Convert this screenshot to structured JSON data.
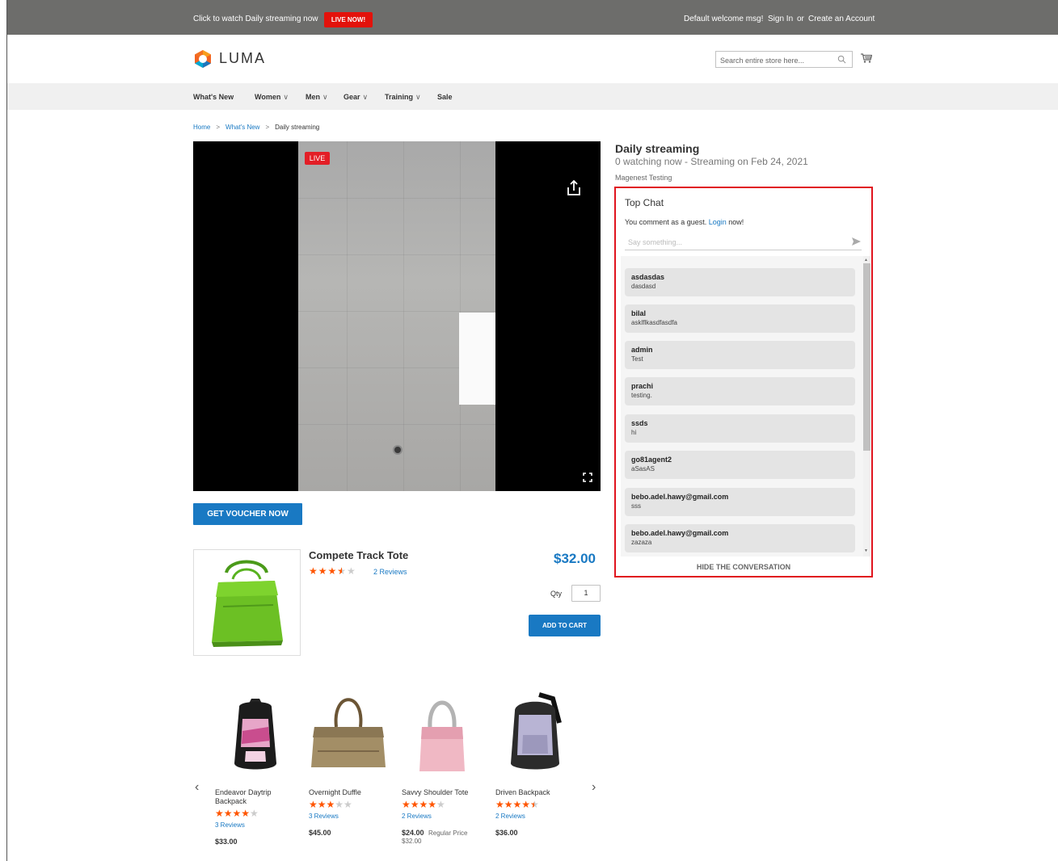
{
  "topbar": {
    "promo": "Click to watch Daily streaming now",
    "live_button": "LIVE NOW!",
    "welcome": "Default welcome msg!",
    "sign_in": "Sign In",
    "or": "or",
    "create_account": "Create an Account"
  },
  "header": {
    "logo_text": "LUMA",
    "search_placeholder": "Search entire store here...",
    "search_icon": "search-icon",
    "cart_icon": "cart-icon"
  },
  "nav": {
    "items": [
      {
        "label": "What's New"
      },
      {
        "label": "Women"
      },
      {
        "label": "Men"
      },
      {
        "label": "Gear"
      },
      {
        "label": "Training"
      },
      {
        "label": "Sale"
      }
    ],
    "chevron": "∨"
  },
  "breadcrumb": {
    "home": "Home",
    "whats_new": "What's New",
    "current": "Daily streaming",
    "separator": ">"
  },
  "video": {
    "live_tag": "LIVE",
    "share_icon": "share-icon",
    "fullscreen_icon": "fullscreen-icon"
  },
  "voucher_button": "GET VOUCHER NOW",
  "product": {
    "name": "Compete Track Tote",
    "rating_stars": 3.5,
    "reviews": "2 Reviews",
    "price": "$32.00",
    "qty_label": "Qty",
    "qty_value": "1",
    "add_to_cart": "ADD TO CART"
  },
  "related": {
    "prev_arrow": "‹",
    "next_arrow": "›",
    "items": [
      {
        "name": "Endeavor Daytrip Backpack",
        "stars": 4,
        "reviews": "3 Reviews",
        "price": "$33.00"
      },
      {
        "name": "Overnight Duffle",
        "stars": 3,
        "reviews": "3 Reviews",
        "price": "$45.00"
      },
      {
        "name": "Savvy Shoulder Tote",
        "stars": 4,
        "reviews": "2 Reviews",
        "price": "$24.00",
        "regular_label": "Regular Price",
        "regular_price": "$32.00"
      },
      {
        "name": "Driven Backpack",
        "stars": 4.5,
        "reviews": "2 Reviews",
        "price": "$36.00"
      }
    ]
  },
  "stream": {
    "title": "Daily streaming",
    "meta": "0 watching now - Streaming on Feb 24, 2021",
    "org": "Magenest Testing"
  },
  "chat": {
    "title": "Top Chat",
    "guest_text": "You comment as a guest.",
    "login": "Login",
    "now": "now!",
    "input_placeholder": "Say something...",
    "send_icon": "send-icon",
    "hide": "HIDE THE CONVERSATION",
    "messages": [
      {
        "user": "asdasdas",
        "text": "dasdasd"
      },
      {
        "user": "bilal",
        "text": "asklflkasdfasdfa"
      },
      {
        "user": "admin",
        "text": "Test"
      },
      {
        "user": "prachi",
        "text": "testing."
      },
      {
        "user": "ssds",
        "text": "hi"
      },
      {
        "user": "go81agent2",
        "text": "aSasAS"
      },
      {
        "user": "bebo.adel.hawy@gmail.com",
        "text": "sss"
      },
      {
        "user": "bebo.adel.hawy@gmail.com",
        "text": "zazaza"
      }
    ]
  },
  "colors": {
    "topbar": "#6d6d6b",
    "accent_blue": "#1979c3",
    "live_red": "#e3120b",
    "star_orange": "#ff5501",
    "chat_border": "#e0141e"
  }
}
